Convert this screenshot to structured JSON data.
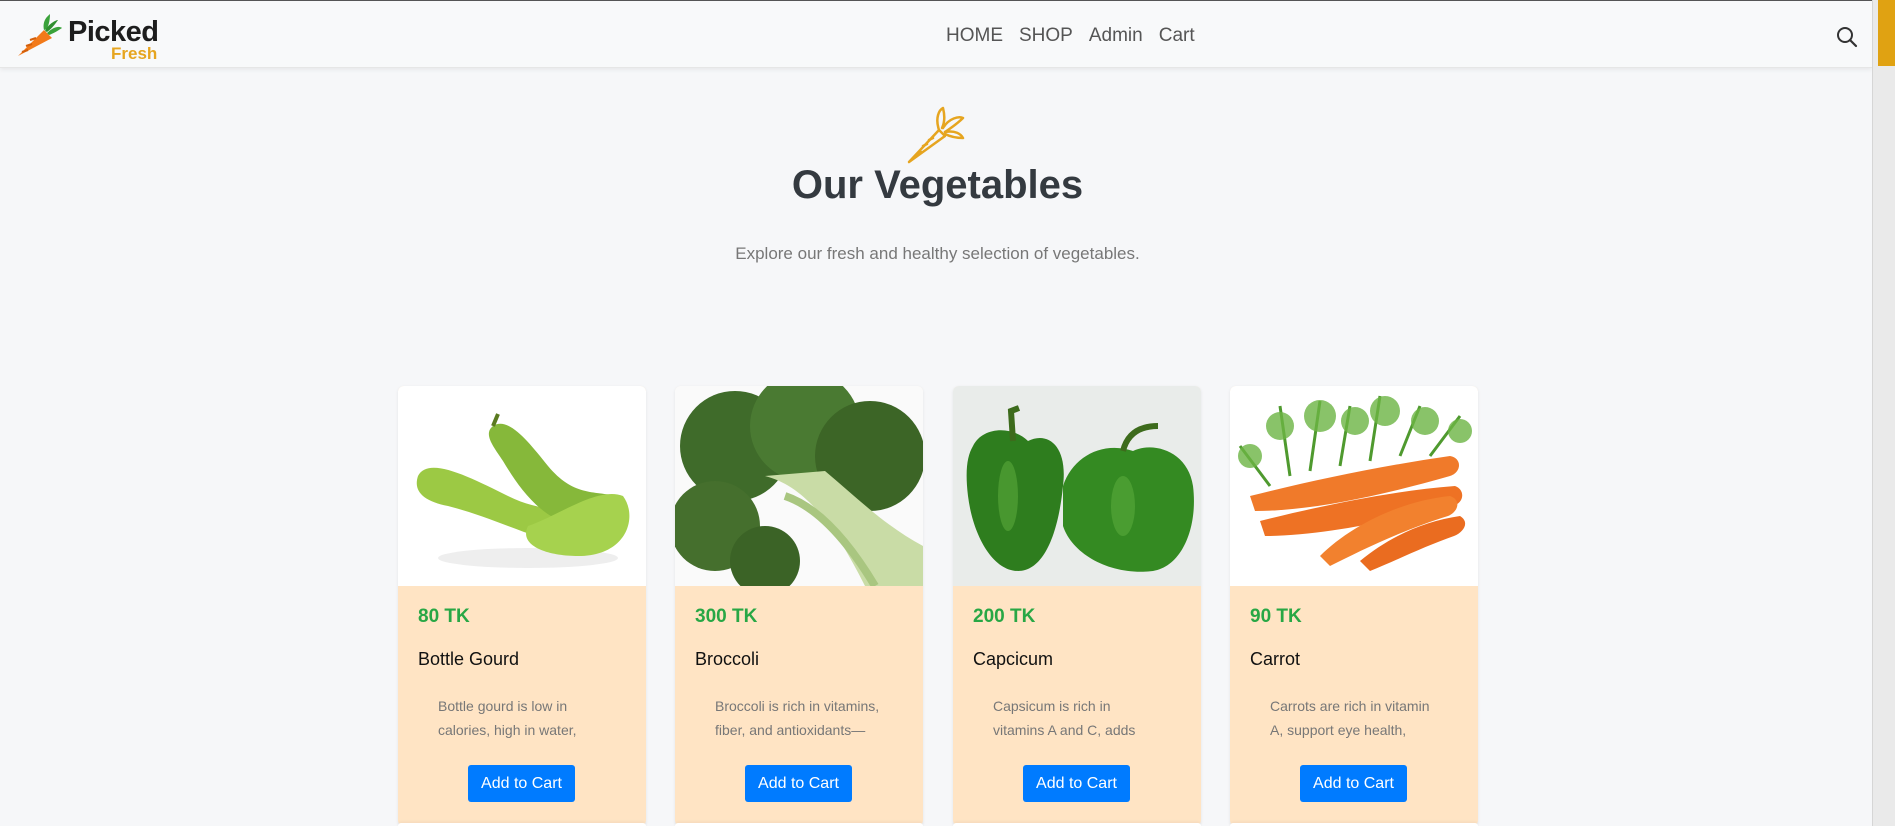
{
  "brand": {
    "name": "Picked",
    "tagline": "Fresh",
    "icon": "carrot-logo-icon"
  },
  "nav": {
    "items": [
      "HOME",
      "SHOP",
      "Admin",
      "Cart"
    ]
  },
  "search": {
    "icon": "search-icon"
  },
  "hero": {
    "icon": "carrot-outline-icon",
    "title": "Our Vegetables",
    "subtitle": "Explore our fresh and healthy selection of vegetables."
  },
  "products": [
    {
      "price": "80 TK",
      "name": "Bottle Gourd",
      "description": "Bottle gourd is low in calories, high in water,",
      "button": "Add to Cart",
      "image": "bottle-gourd-image"
    },
    {
      "price": "300 TK",
      "name": "Broccoli",
      "description": "Broccoli is rich in vitamins, fiber, and antioxidants—",
      "button": "Add to Cart",
      "image": "broccoli-image"
    },
    {
      "price": "200 TK",
      "name": "Capcicum",
      "description": "Capsicum is rich in vitamins A and C, adds",
      "button": "Add to Cart",
      "image": "capsicum-image"
    },
    {
      "price": "90 TK",
      "name": "Carrot",
      "description": "Carrots are rich in vitamin A, support eye health,",
      "button": "Add to Cart",
      "image": "carrot-image"
    }
  ],
  "colors": {
    "price": "#28a745",
    "button": "#007bff",
    "card_body": "#ffe4c4",
    "accent": "#e6a520"
  }
}
